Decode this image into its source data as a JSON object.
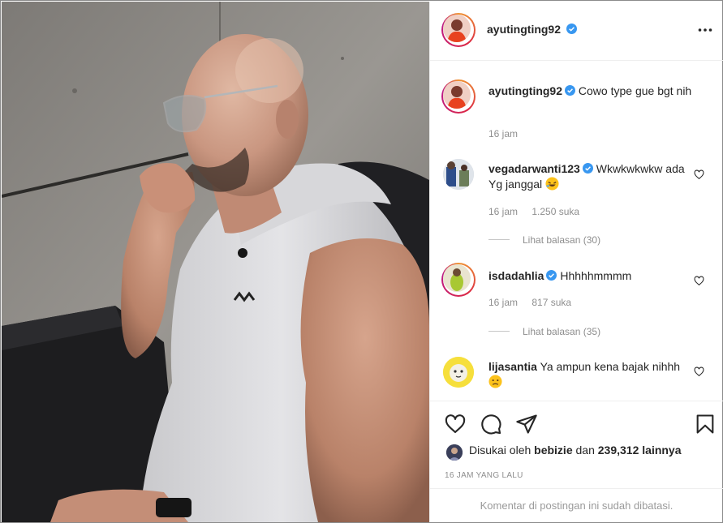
{
  "post": {
    "author": "ayutingting92",
    "author_verified": true,
    "more_options_icon": "more-horizontal-icon"
  },
  "caption": {
    "username": "ayutingting92",
    "text": "Cowo type gue bgt nih",
    "time": "16 jam"
  },
  "comments": [
    {
      "username": "vegadarwanti123",
      "verified": true,
      "text": "Wkwkwkwkw ada Yg janggal",
      "emoji": "rofl-emoji",
      "time": "16 jam",
      "likes": "1.250 suka",
      "replies": "Lihat balasan (30)"
    },
    {
      "username": "isdadahlia",
      "verified": true,
      "text": "Hhhhhmmmm",
      "time": "16 jam",
      "likes": "817 suka",
      "replies": "Lihat balasan (35)"
    },
    {
      "username": "lijasantia",
      "verified": false,
      "text": "Ya ampun kena bajak nihhh",
      "emoji": "frowning-emoji"
    }
  ],
  "actions": {
    "like_icon": "heart-icon",
    "comment_icon": "comment-icon",
    "share_icon": "paper-plane-icon",
    "save_icon": "bookmark-icon"
  },
  "likes_summary": {
    "prefix": "Disukai oleh",
    "first_user": "bebizie",
    "connector": "dan",
    "others": "239,312 lainnya"
  },
  "time_ago": "16 JAM YANG LALU",
  "comments_disabled": "Komentar di postingan ini sudah dibatasi.",
  "colors": {
    "verified_badge": "#3897f0",
    "text_primary": "#262626",
    "text_secondary": "#8e8e8e",
    "divider": "#efefef"
  }
}
